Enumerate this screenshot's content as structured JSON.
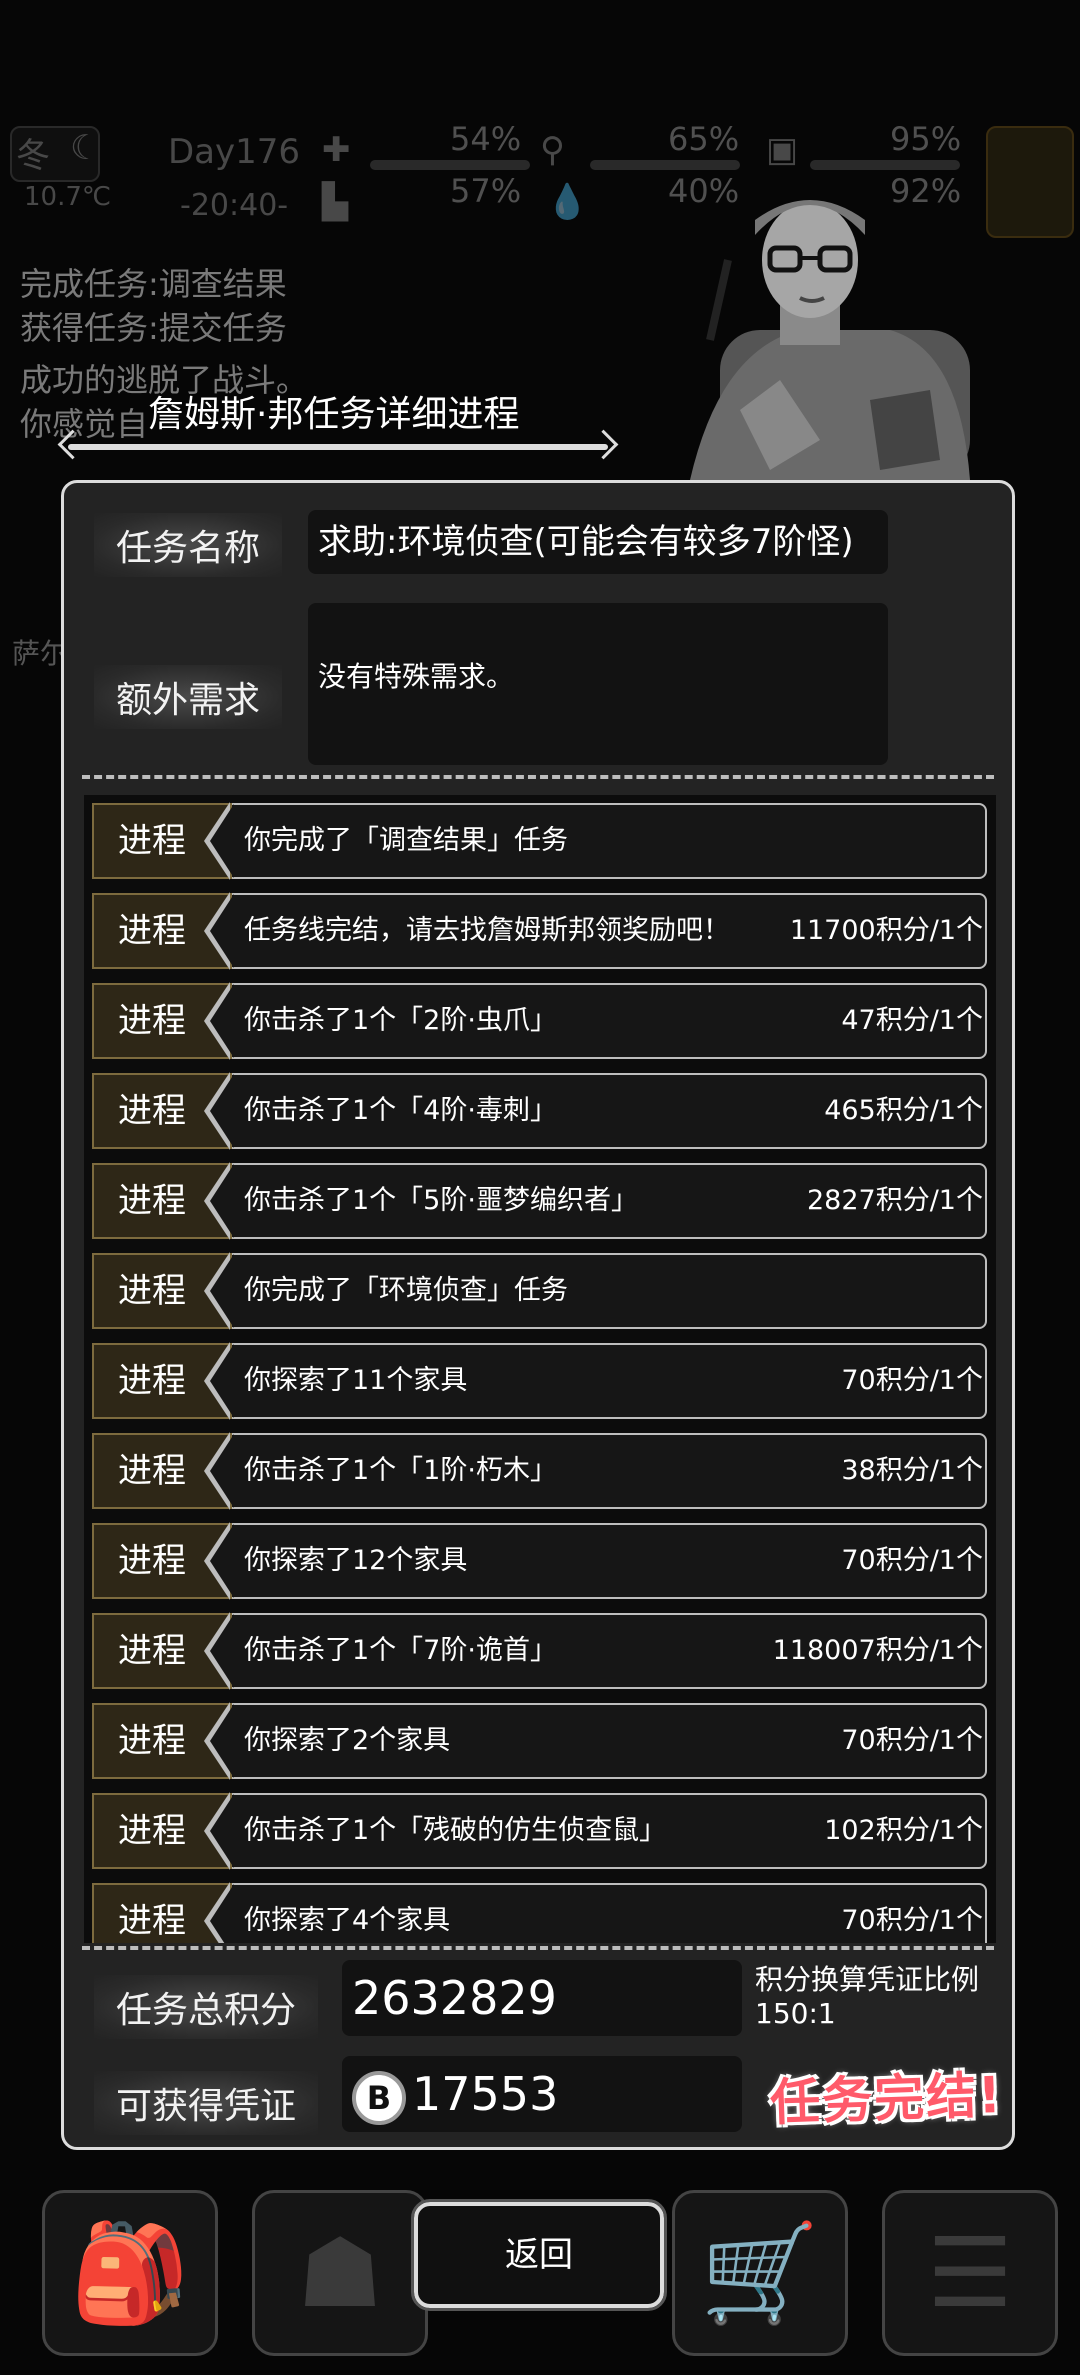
{
  "hud": {
    "season": "冬",
    "temperature": "10.7℃",
    "day": "Day176",
    "time": "-20:40-",
    "stats": [
      "54%",
      "65%",
      "95%",
      "57%",
      "40%",
      "92%"
    ]
  },
  "log_lines": [
    "完成任务:调查结果",
    "获得任务:提交任务",
    "成功的逃脱了战斗。",
    "你感觉自"
  ],
  "side_label": "萨尔",
  "modal": {
    "title": "詹姆斯·邦任务详细进程",
    "task_name_label": "任务名称",
    "task_name": "求助:环境侦查(可能会有较多7阶怪)",
    "extra_label": "额外需求",
    "extra_value": "没有特殊需求。",
    "rows": [
      {
        "tag": "进程",
        "text": "你完成了「调查结果」任务",
        "score": ""
      },
      {
        "tag": "进程",
        "text": "任务线完结，请去找詹姆斯邦领奖励吧！",
        "score": "11700积分/1个"
      },
      {
        "tag": "进程",
        "text": "你击杀了1个「2阶·虫爪」",
        "score": "47积分/1个"
      },
      {
        "tag": "进程",
        "text": "你击杀了1个「4阶·毒刺」",
        "score": "465积分/1个"
      },
      {
        "tag": "进程",
        "text": "你击杀了1个「5阶·噩梦编织者」",
        "score": "2827积分/1个"
      },
      {
        "tag": "进程",
        "text": "你完成了「环境侦查」任务",
        "score": ""
      },
      {
        "tag": "进程",
        "text": "你探索了11个家具",
        "score": "70积分/1个"
      },
      {
        "tag": "进程",
        "text": "你击杀了1个「1阶·朽木」",
        "score": "38积分/1个"
      },
      {
        "tag": "进程",
        "text": "你探索了12个家具",
        "score": "70积分/1个"
      },
      {
        "tag": "进程",
        "text": "你击杀了1个「7阶·诡首」",
        "score": "118007积分/1个"
      },
      {
        "tag": "进程",
        "text": "你探索了2个家具",
        "score": "70积分/1个"
      },
      {
        "tag": "进程",
        "text": "你击杀了1个「残破的仿生侦查鼠」",
        "score": "102积分/1个"
      },
      {
        "tag": "进程",
        "text": "你探索了4个家具",
        "score": "70积分/1个"
      }
    ],
    "total_label": "任务总积分",
    "total_value": "2632829",
    "ratio_label": "积分换算凭证比例",
    "ratio_value": "150:1",
    "voucher_label": "可获得凭证",
    "coin_glyph": "B",
    "voucher_value": "17553",
    "complete_text": "任务完结!"
  },
  "back_label": "返回"
}
